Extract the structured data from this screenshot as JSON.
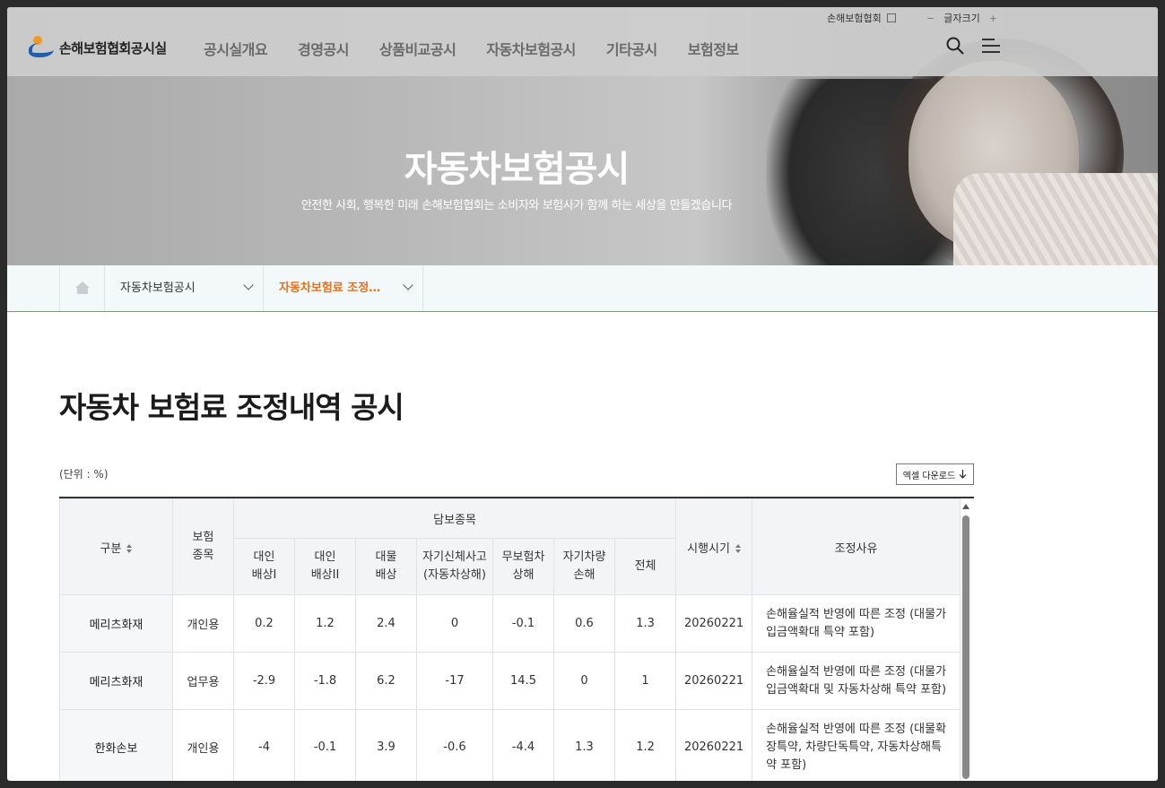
{
  "util": {
    "association": "손해보험협회",
    "font_size": "글자크기",
    "minus": "−",
    "plus": "+"
  },
  "logo": {
    "text": "손해보험협회공시실"
  },
  "gnb": [
    "공시실개요",
    "경영공시",
    "상품비교공시",
    "자동차보험공시",
    "기타공시",
    "보험정보"
  ],
  "hero": {
    "title": "자동차보험공시",
    "subtitle": "안전한 사회, 행복한 미래 손해보험협회는 소비자와 보험사가 함께 하는 세상을 만들겠습니다"
  },
  "breadcrumb": {
    "level1": "자동차보험공시",
    "level2": "자동차보험료 조정…"
  },
  "page": {
    "title": "자동차 보험료 조정내역 공시",
    "unit": "(단위 : %)",
    "excel_button": "엑셀 다운로드"
  },
  "table": {
    "headers": {
      "division": "구분",
      "kind": "보험\n종목",
      "group": "담보종목",
      "bodily1": "대인\n배상I",
      "bodily2": "대인\n배상II",
      "property": "대물\n배상",
      "self_injury": "자기신체사고\n(자동차상해)",
      "uninsured": "무보험차\n상해",
      "own_vehicle": "자기차량\n손해",
      "total": "전체",
      "effective": "시행시기",
      "reason": "조정사유"
    },
    "rows": [
      {
        "company": "메리츠화재",
        "kind": "개인용",
        "b1": "0.2",
        "b2": "1.2",
        "prop": "2.4",
        "self": "0",
        "unins": "-0.1",
        "own": "0.6",
        "total": "1.3",
        "date": "20260221",
        "reason": "손해율실적 반영에 따른 조정 (대물가입금액확대 특약 포함)"
      },
      {
        "company": "메리츠화재",
        "kind": "업무용",
        "b1": "-2.9",
        "b2": "-1.8",
        "prop": "6.2",
        "self": "-17",
        "unins": "14.5",
        "own": "0",
        "total": "1",
        "date": "20260221",
        "reason": "손해율실적 반영에 따른 조정 (대물가입금액확대 및 자동차상해 특약 포함)"
      },
      {
        "company": "한화손보",
        "kind": "개인용",
        "b1": "-4",
        "b2": "-0.1",
        "prop": "3.9",
        "self": "-0.6",
        "unins": "-4.4",
        "own": "1.3",
        "total": "1.2",
        "date": "20260221",
        "reason": "손해율실적 반영에 따른 조정 (대물확장특약, 차량단독특약, 자동차상해특약 포함)"
      }
    ]
  }
}
